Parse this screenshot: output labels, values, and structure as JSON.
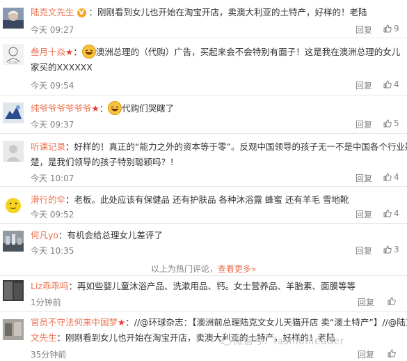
{
  "comments": [
    {
      "name": "陆克文先生",
      "text": "：刚刚看到女儿也开始在淘宝开店，卖澳大利亚的土特产，好样的！老陆",
      "time": "今天 09:27",
      "reply": "回复",
      "likes": "9"
    },
    {
      "name": "叁月十焱",
      "text1": "澳洲总理的（代购）广告，买起来会不会特别有面子！这是我在澳洲总理的女儿",
      "text2": "家买的XXXXXX",
      "time": "今天 09:54",
      "reply": "回复",
      "likes": "4"
    },
    {
      "name": "纯爷爷爷爷爷爷",
      "text": "代购们哭瞎了",
      "time": "今天 09:37",
      "reply": "回复",
      "likes": "5"
    },
    {
      "name": "听课记录",
      "text1": "：好样的！真正的“能力之外的资本等于零”。反观中国领导的孩子无一不是中国各个行业翘",
      "text2": "楚，是我们领导的孩子特别聪颖吗？！",
      "time": "今天 10:07",
      "reply": "回复",
      "likes": "4"
    },
    {
      "name": "滑行的伞",
      "text": "：老板。此处应该有保健品 还有护肤品 各种沐浴露 蜂蜜 还有羊毛 雪地靴",
      "time": "今天 09:52",
      "reply": "回复",
      "likes": "4"
    },
    {
      "name": "何凡yo",
      "text": "：有机会给总理女儿差评了",
      "time": "今天 10:35",
      "reply": "回复",
      "likes": "3"
    },
    {
      "name": "Liz乖乖吗",
      "text": "：再如些婴儿童沐浴产品、洗漱用品、钙。女士营养品、羊胎素、面膜等等",
      "time": "1分钟前",
      "reply": "回复"
    },
    {
      "name": "官员不守法何来中国梦",
      "text1": "：//@环球杂志：【澳洲前总理陆克文女儿天猫开店 卖“澳土特产”】//@陆克",
      "name2": "文先生",
      "text2": "：刚刚看到女儿也开始在淘宝开店，卖澳大利亚的土特产，好样的！老陆",
      "time": "35分钟前",
      "reply": "回复"
    }
  ],
  "hot_footer": {
    "text": "以上为热门评论，",
    "link": "查看更多»"
  },
  "watermark": "微信号：fashionleader",
  "colors": {
    "name": "#eb7350",
    "meta": "#808080",
    "star": "#e8392d"
  }
}
